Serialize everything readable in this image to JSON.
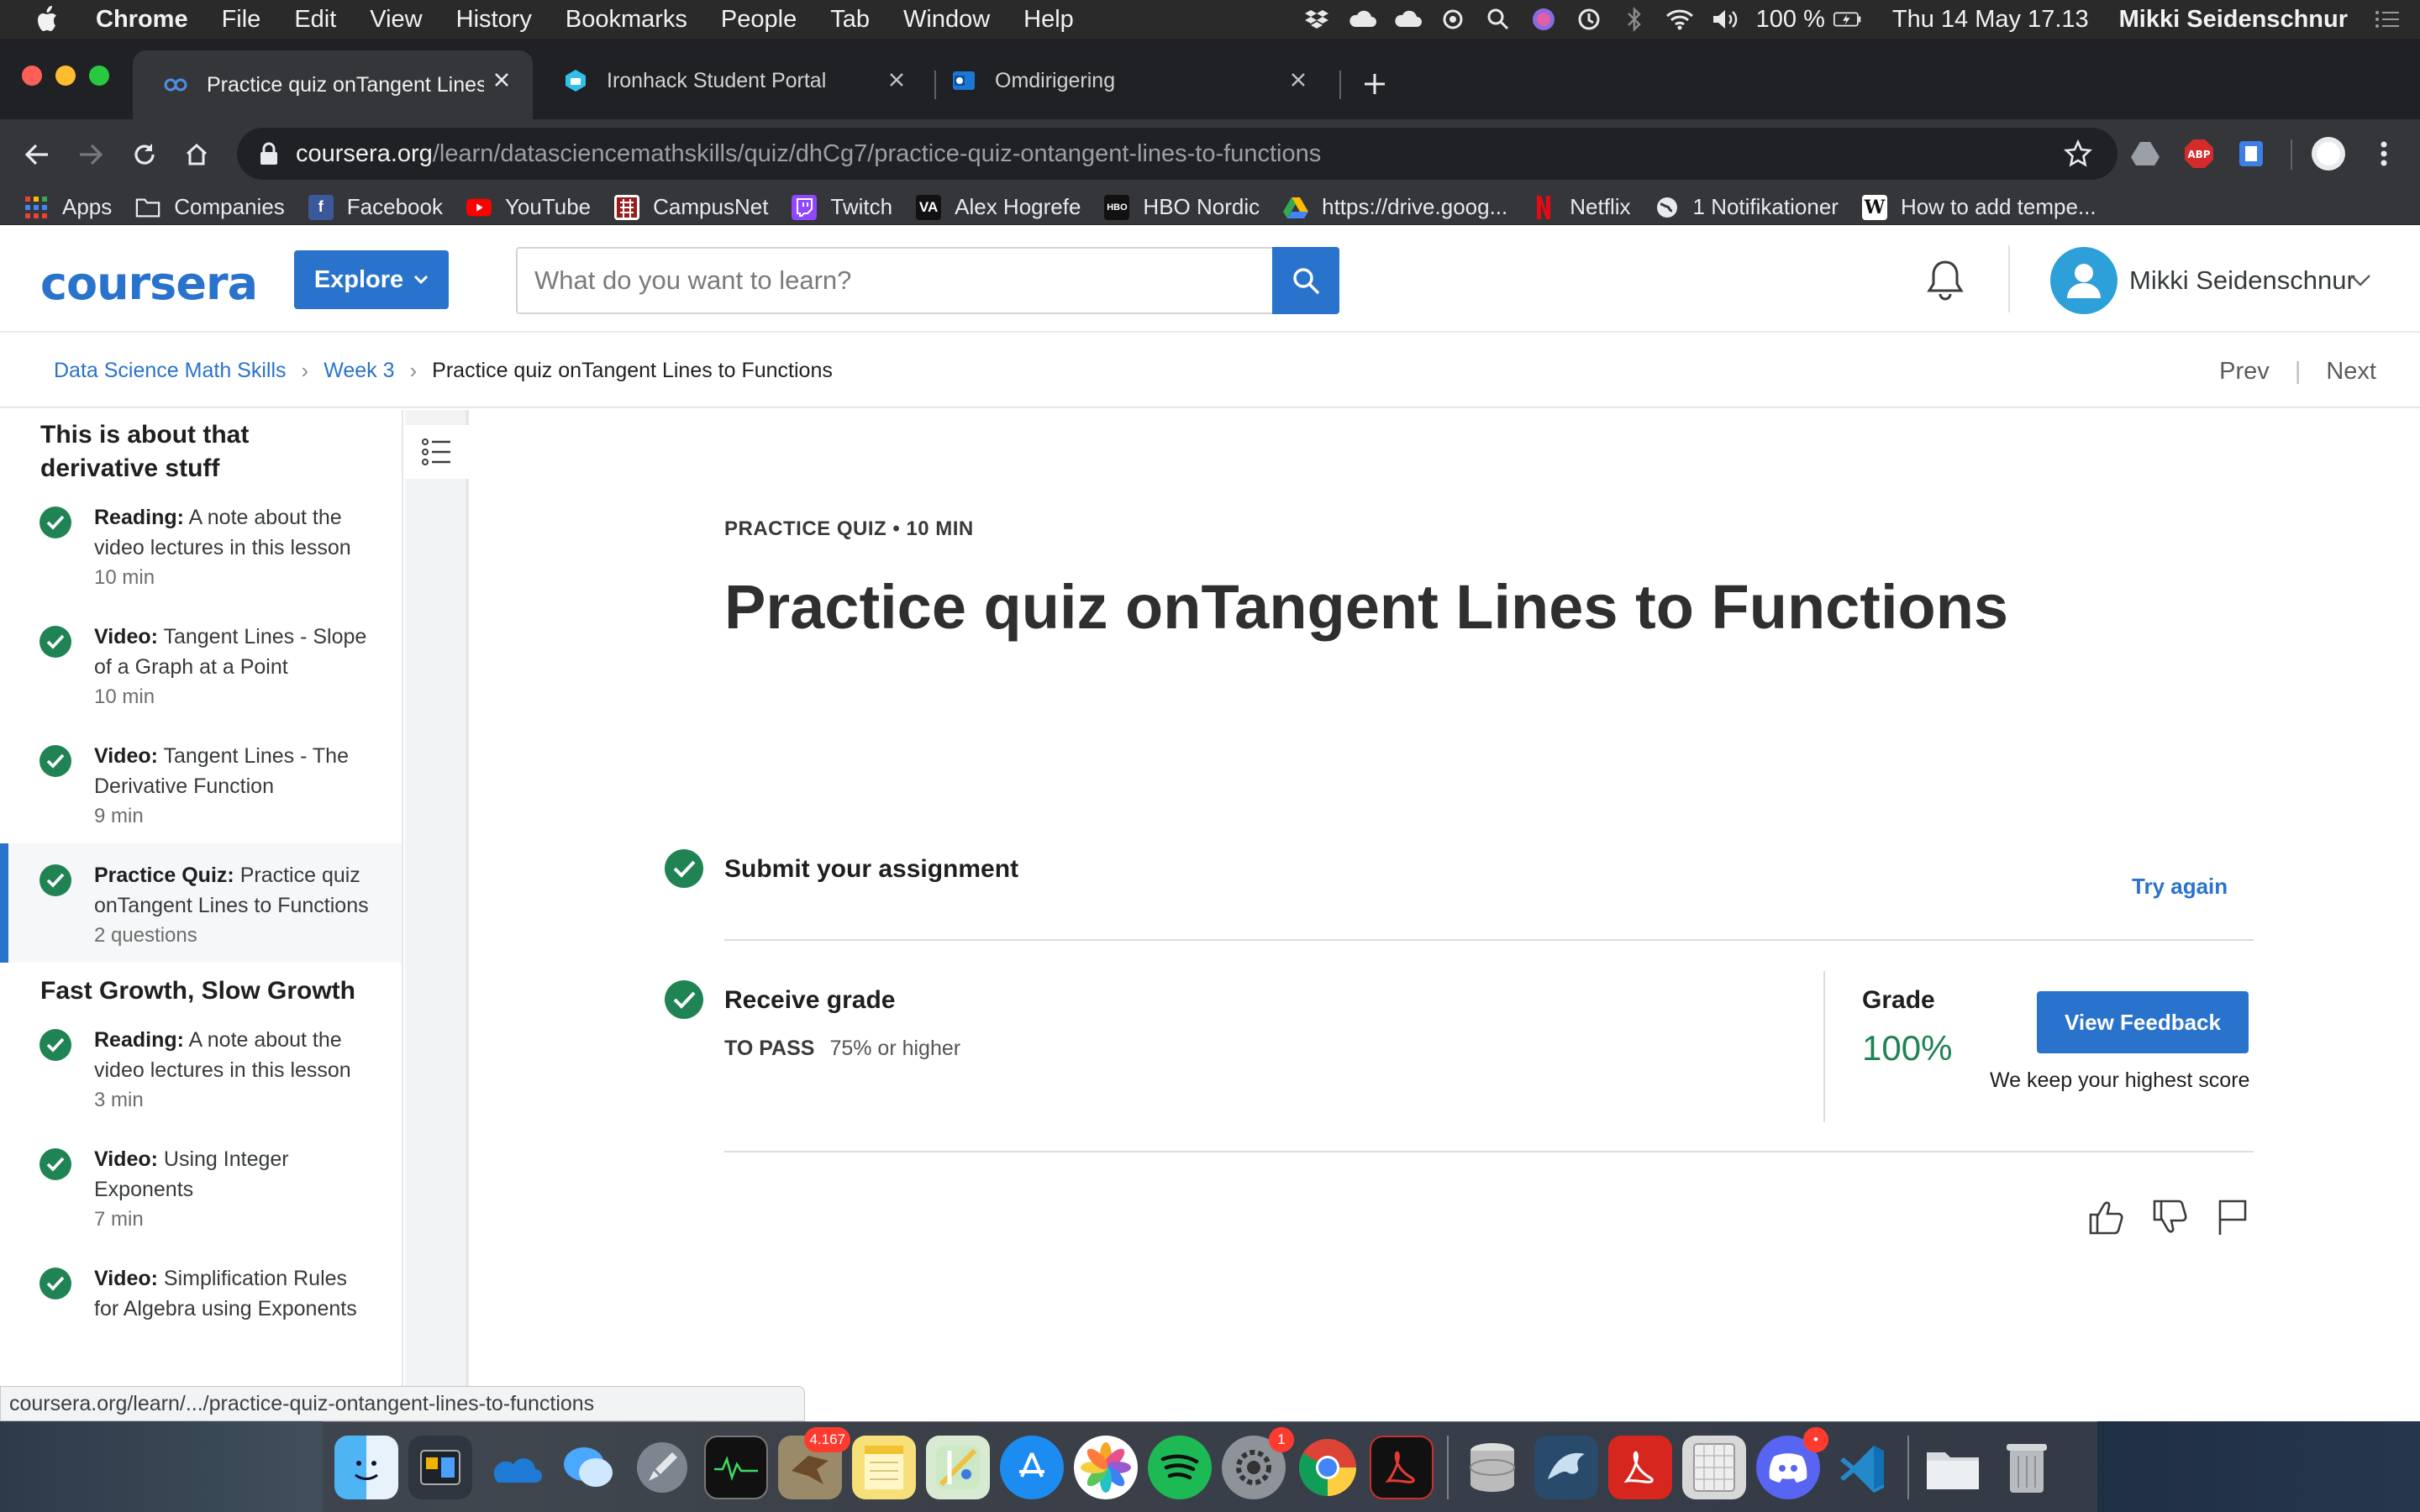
{
  "menubar": {
    "app_name": "Chrome",
    "menus": [
      "File",
      "Edit",
      "View",
      "History",
      "Bookmarks",
      "People",
      "Tab",
      "Window",
      "Help"
    ],
    "battery": "100 %",
    "datetime": "Thu 14 May  17.13",
    "user": "Mikki Seidenschnur"
  },
  "tabs": [
    {
      "title": "Practice quiz onTangent Lines t",
      "active": true
    },
    {
      "title": "Ironhack Student Portal",
      "active": false
    },
    {
      "title": "Omdirigering",
      "active": false
    }
  ],
  "address_bar": {
    "host": "coursera.org",
    "path": "/learn/datasciencemathskills/quiz/dhCg7/practice-quiz-ontangent-lines-to-functions"
  },
  "bookmarks": [
    {
      "label": "Apps",
      "icon": "apps-grid-icon"
    },
    {
      "label": "Companies",
      "icon": "folder-icon"
    },
    {
      "label": "Facebook",
      "icon": "facebook-icon"
    },
    {
      "label": "YouTube",
      "icon": "youtube-icon"
    },
    {
      "label": "CampusNet",
      "icon": "campusnet-icon"
    },
    {
      "label": "Twitch",
      "icon": "twitch-icon"
    },
    {
      "label": "Alex Hogrefe",
      "icon": "va-icon"
    },
    {
      "label": "HBO Nordic",
      "icon": "hbo-icon"
    },
    {
      "label": "https://drive.goog...",
      "icon": "google-drive-icon"
    },
    {
      "label": "Netflix",
      "icon": "netflix-icon"
    },
    {
      "label": "1 Notifikationer",
      "icon": "globe-icon"
    },
    {
      "label": "How to add tempe...",
      "icon": "wikipedia-icon"
    }
  ],
  "coursera_header": {
    "logo": "coursera",
    "explore_label": "Explore",
    "search_placeholder": "What do you want to learn?",
    "user_name": "Mikki Seidenschnur"
  },
  "breadcrumb": {
    "items": [
      "Data Science Math Skills",
      "Week 3",
      "Practice quiz onTangent Lines to Functions"
    ],
    "prev": "Prev",
    "next": "Next"
  },
  "sidebar": {
    "sections": [
      {
        "title": "This is about that derivative stuff",
        "lessons": [
          {
            "type": "Reading:",
            "title": "A note about the video lectures in this lesson",
            "meta": "10 min",
            "active": false
          },
          {
            "type": "Video:",
            "title": "Tangent Lines - Slope of a Graph at a Point",
            "meta": "10 min",
            "active": false
          },
          {
            "type": "Video:",
            "title": "Tangent Lines - The Derivative Function",
            "meta": "9 min",
            "active": false
          },
          {
            "type": "Practice Quiz:",
            "title": "Practice quiz onTangent Lines to Functions",
            "meta": "2 questions",
            "active": true
          }
        ]
      },
      {
        "title": "Fast Growth, Slow Growth",
        "lessons": [
          {
            "type": "Reading:",
            "title": "A note about the video lectures in this lesson",
            "meta": "3 min",
            "active": false
          },
          {
            "type": "Video:",
            "title": "Using Integer Exponents",
            "meta": "7 min",
            "active": false
          },
          {
            "type": "Video:",
            "title": "Simplification Rules for Algebra using Exponents",
            "meta": "",
            "active": false
          }
        ]
      }
    ]
  },
  "quiz": {
    "kicker": "PRACTICE QUIZ • 10 MIN",
    "title": "Practice quiz onTangent Lines to Functions",
    "submit_label": "Submit your assignment",
    "try_again": "Try again",
    "receive_label": "Receive grade",
    "to_pass_label": "TO PASS",
    "to_pass_value": "75% or higher",
    "grade_label": "Grade",
    "grade_value": "100%",
    "view_feedback": "View Feedback",
    "highest_score_note": "We keep your highest score"
  },
  "status_url": "coursera.org/learn/.../practice-quiz-ontangent-lines-to-functions",
  "dock": {
    "badges": {
      "mail": "4.167",
      "system_prefs": "1",
      "discord": "•"
    }
  },
  "colors": {
    "coursera_blue": "#2a73cc",
    "success_green": "#1f8354",
    "check_green": "#1f8354"
  }
}
